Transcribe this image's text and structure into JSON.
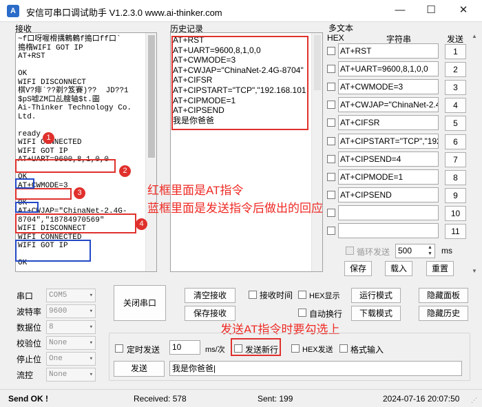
{
  "window": {
    "title": "安信可串口调试助手 V1.2.3.0 www.ai-thinker.com",
    "minimize": "—",
    "maximize": "☐",
    "close": "✕"
  },
  "receive": {
    "label": "接收",
    "lines": [
      "~f口呀喔榾搆鶇鶇f搗口ff口`",
      "搗楕WIFI GOT IP",
      "AT+RST",
      "",
      "OK",
      "WIFI DISCONNECT",
      "棋V?痱`??剃?笈賽)??  JD??1",
      "$pS嘘ZM口乩艘轴$t.圖",
      "Ai-Thinker Technology Co.",
      "Ltd.",
      "",
      "ready",
      "WIFI CONNECTED",
      "WIFI GOT IP",
      "AT+UART=9600,8,1,0,0",
      "",
      "OK",
      "AT+CWMODE=3",
      "",
      "OK",
      "AT+CWJAP=\"ChinaNet-2.4G-",
      "8704\",\"18784970569\"",
      "WIFI DISCONNECT",
      "WIFI CONNECTED",
      "WIFI GOT IP",
      "",
      "OK"
    ]
  },
  "history": {
    "label": "历史记录",
    "items": [
      "AT+RST",
      "AT+UART=9600,8,1,0,0",
      "AT+CWMODE=3",
      "AT+CWJAP=\"ChinaNet-2.4G-8704\"",
      "AT+CIFSR",
      "AT+CIPSTART=\"TCP\",\"192.168.101",
      "AT+CIPMODE=1",
      "AT+CIPSEND",
      "我是你爸爸"
    ]
  },
  "multitext": {
    "label": "多文本",
    "col_hex": "HEX",
    "col_string": "字符串",
    "col_send": "发送",
    "rows": [
      {
        "text": "AT+RST",
        "btn": "1"
      },
      {
        "text": "AT+UART=9600,8,1,0,0",
        "btn": "2"
      },
      {
        "text": "AT+CWMODE=3",
        "btn": "3"
      },
      {
        "text": "AT+CWJAP=\"ChinaNet-2.4",
        "btn": "4"
      },
      {
        "text": "AT+CIFSR",
        "btn": "5"
      },
      {
        "text": "AT+CIPSTART=\"TCP\",\"192",
        "btn": "6"
      },
      {
        "text": "AT+CIPSEND=4",
        "btn": "7"
      },
      {
        "text": "AT+CIPMODE=1",
        "btn": "8"
      },
      {
        "text": "AT+CIPSEND",
        "btn": "9"
      },
      {
        "text": "",
        "btn": "10"
      },
      {
        "text": "",
        "btn": "11"
      }
    ],
    "loop_send": "循环发送",
    "loop_ms": "500",
    "ms_unit": "ms",
    "save": "保存",
    "load": "载入",
    "reset": "重置"
  },
  "serial": {
    "port_label": "串口",
    "port_value": "COM5",
    "baud_label": "波特率",
    "baud_value": "9600",
    "databits_label": "数据位",
    "databits_value": "8",
    "parity_label": "校验位",
    "parity_value": "None",
    "stopbits_label": "停止位",
    "stopbits_value": "One",
    "flow_label": "流控",
    "flow_value": "None"
  },
  "controls": {
    "close_port": "关闭串口",
    "clear_recv": "清空接收",
    "save_recv": "保存接收",
    "recv_time": "接收时间",
    "hex_display": "HEX显示",
    "auto_newline": "自动换行",
    "run_mode": "运行模式",
    "download_mode": "下载模式",
    "hide_panel": "隐藏面板",
    "hide_history": "隐藏历史",
    "timed_send": "定时发送",
    "timed_value": "10",
    "timed_unit": "ms/次",
    "send_newline": "发送新行",
    "hex_send": "HEX发送",
    "format_input": "格式输入",
    "send": "发送",
    "send_text": "我是你爸爸|"
  },
  "annotations": {
    "red_note": "红框里面是AT指令",
    "blue_note": "蓝框里面是发送指令后做出的回应",
    "send_note": "发送AT指令时要勾选上",
    "badges": [
      "1",
      "2",
      "3",
      "4"
    ]
  },
  "status": {
    "send_ok": "Send OK !",
    "received": "Received: 578",
    "sent": "Sent: 199",
    "timestamp": "2024-07-16 20:07:50"
  },
  "colors": {
    "red": "#e0302c",
    "blue": "#2248c6",
    "note_red": "#ee2a24"
  }
}
